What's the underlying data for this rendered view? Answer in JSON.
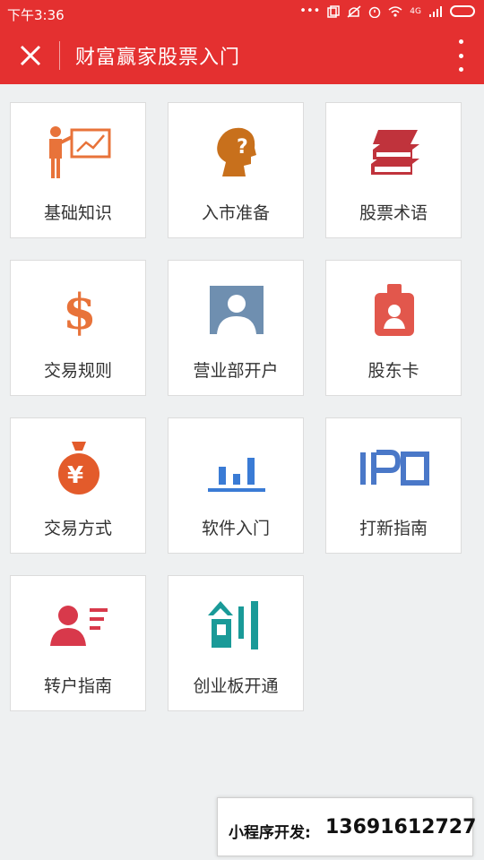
{
  "status_bar": {
    "time": "下午3:36",
    "network_label": "4G"
  },
  "header": {
    "title": "财富赢家股票入门"
  },
  "colors": {
    "brand_red": "#e43030",
    "orange": "#e8733a",
    "blue": "#3a7bd5",
    "red": "#d8394b",
    "teal": "#1a9a98"
  },
  "tiles": [
    {
      "label": "基础知识",
      "icon": "presentation-icon"
    },
    {
      "label": "入市准备",
      "icon": "question-head-icon"
    },
    {
      "label": "股票术语",
      "icon": "books-icon"
    },
    {
      "label": "交易规则",
      "icon": "dollar-icon"
    },
    {
      "label": "营业部开户",
      "icon": "person-portrait-icon"
    },
    {
      "label": "股东卡",
      "icon": "id-badge-icon"
    },
    {
      "label": "交易方式",
      "icon": "money-bag-icon"
    },
    {
      "label": "软件入门",
      "icon": "bar-chart-icon"
    },
    {
      "label": "打新指南",
      "icon": "ipo-icon"
    },
    {
      "label": "转户指南",
      "icon": "transfer-user-icon"
    },
    {
      "label": "创业板开通",
      "icon": "chuang-icon"
    }
  ],
  "developer_banner": {
    "label": "小程序开发:",
    "phone": "13691612727"
  }
}
